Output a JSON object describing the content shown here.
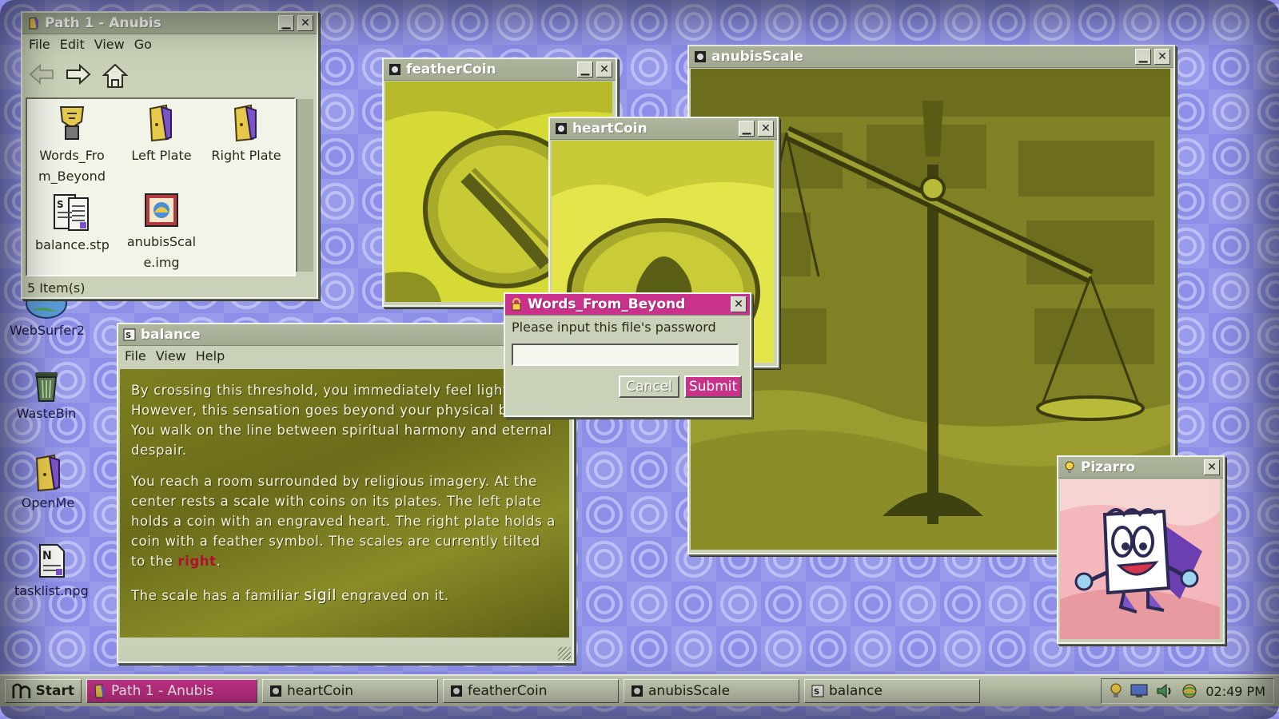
{
  "desktop": {
    "icons": [
      {
        "label": "WebSurfer2"
      },
      {
        "label": "WasteBin"
      },
      {
        "label": "OpenMe"
      },
      {
        "label": "tasklist.npg"
      }
    ]
  },
  "explorer": {
    "title": "Path 1 - Anubis",
    "menu": [
      "File",
      "Edit",
      "View",
      "Go"
    ],
    "files": [
      {
        "label": "Words_From_Beyond"
      },
      {
        "label": "Left Plate"
      },
      {
        "label": "Right Plate"
      },
      {
        "label": "balance.stp"
      },
      {
        "label": "anubisScale.img"
      }
    ],
    "status": "5 Item(s)"
  },
  "featherCoin": {
    "title": "featherCoin"
  },
  "heartCoin": {
    "title": "heartCoin"
  },
  "anubisScale": {
    "title": "anubisScale"
  },
  "balance": {
    "title": "balance",
    "menu": [
      "File",
      "View",
      "Help"
    ],
    "paragraph1": "By crossing this threshold, you immediately feel lighter. However, this sensation goes beyond your physical body. You walk on the line between spiritual harmony and eternal despair.",
    "paragraph2_before": "You reach a room surrounded by religious imagery. At the center rests a scale with coins on its plates. The left plate holds a coin with an engraved heart. The right plate holds a coin with a feather symbol. The scales are currently tilted to the ",
    "paragraph2_highlight": "right",
    "paragraph2_after": ".",
    "paragraph3_before": "The scale has a familiar ",
    "paragraph3_highlight": "sigil",
    "paragraph3_after": " engraved on it."
  },
  "password_dialog": {
    "title": "Words_From_Beyond",
    "prompt": "Please input this file's password",
    "input_value": "",
    "cancel_label": "Cancel",
    "submit_label": "Submit"
  },
  "pizarro": {
    "title": "Pizarro"
  },
  "taskbar": {
    "start_label": "Start",
    "tasks": [
      {
        "label": "Path 1 - Anubis"
      },
      {
        "label": "heartCoin"
      },
      {
        "label": "featherCoin"
      },
      {
        "label": "anubisScale"
      },
      {
        "label": "balance"
      }
    ],
    "clock": "02:49 PM"
  },
  "colors": {
    "accent": "#c9328b",
    "desktop": "#8c8ee8",
    "window_face": "#c9d2b8",
    "link_red": "#b01030"
  }
}
